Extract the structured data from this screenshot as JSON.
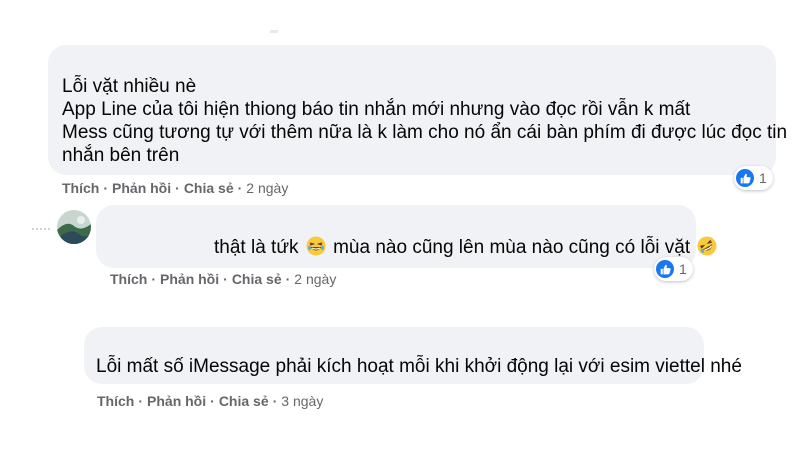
{
  "comments": [
    {
      "lines": [
        "Lỗi vặt nhiều nè",
        "App Line của tôi hiện thiong báo tin nhắn mới nhưng vào đọc rồi vẫn k mất",
        "Mess cũng tương tự với thêm nữa là k làm cho nó ẩn cái bàn phím đi được lúc đọc tin",
        "nhắn bên trên"
      ],
      "like_label": "Thích",
      "reply_label": "Phản hồi",
      "share_label": "Chia sẻ",
      "time": "2 ngày",
      "reaction_count": "1"
    },
    {
      "text_part1": "thật là tứk",
      "text_part2": "mùa nào cũng lên mùa nào cũng có lỗi vặt",
      "emoji_1": "laughing-emoji",
      "emoji_2": "rofl-emoji",
      "like_label": "Thích",
      "reply_label": "Phản hồi",
      "share_label": "Chia sẻ",
      "time": "2 ngày",
      "reaction_count": "1"
    },
    {
      "lines": [
        "Lỗi mất số iMessage phải kích hoạt mỗi khi khởi động lại với esim viettel nhé"
      ],
      "like_label": "Thích",
      "reply_label": "Phản hồi",
      "share_label": "Chia sẻ",
      "time": "3 ngày"
    }
  ],
  "separator": "·",
  "colors": {
    "bubble": "#f0f2f5",
    "meta_text": "#65676b",
    "like_blue": "#1877f2"
  }
}
